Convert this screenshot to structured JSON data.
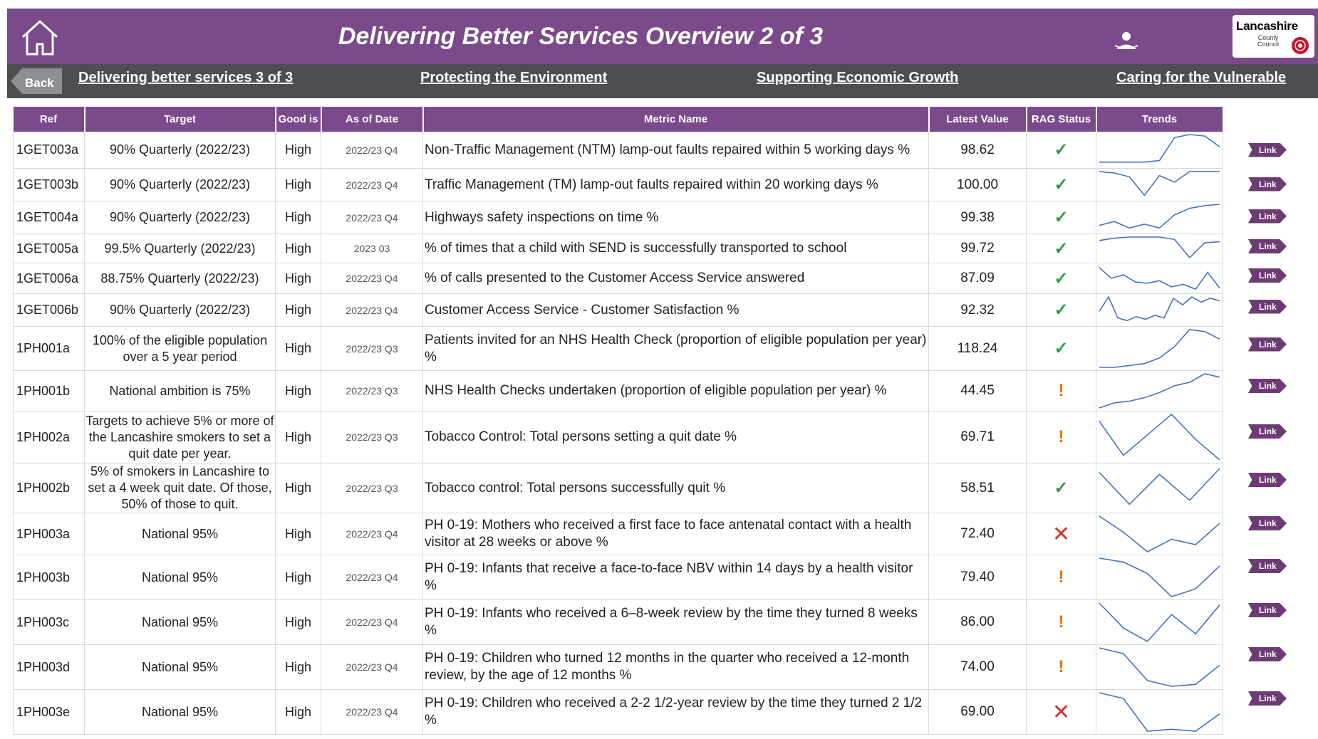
{
  "header": {
    "title": "Delivering Better Services Overview 2 of 3",
    "logo_title": "Lancashire",
    "logo_subtitle": "County Council"
  },
  "nav": {
    "back": "Back",
    "links": [
      "Delivering better services 3 of 3",
      "Protecting the Environment",
      "Supporting Economic Growth",
      "Caring for the Vulnerable"
    ]
  },
  "table": {
    "columns": [
      "Ref",
      "Target",
      "Good is",
      "As of Date",
      "Metric Name",
      "Latest Value",
      "RAG Status",
      "Trends"
    ],
    "link_label": "Link",
    "rows": [
      {
        "ref": "1GET003a",
        "target": "90% Quarterly (2022/23)",
        "good": "High",
        "asof": "2022/23 Q4",
        "metric": "Non-Traffic Management (NTM) lamp-out faults repaired within 5 working days %",
        "latest": "98.62",
        "rag": "green",
        "trend": [
          0.1,
          0.1,
          0.1,
          0.1,
          0.15,
          0.9,
          1.0,
          0.95,
          0.6
        ]
      },
      {
        "ref": "1GET003b",
        "target": "90% Quarterly (2022/23)",
        "good": "High",
        "asof": "2022/23 Q4",
        "metric": "Traffic Management (TM) lamp-out faults repaired within 20 working days %",
        "latest": "100.00",
        "rag": "green",
        "trend": [
          1.0,
          0.95,
          0.8,
          0.1,
          0.85,
          0.6,
          1.0,
          1.0,
          1.0
        ]
      },
      {
        "ref": "1GET004a",
        "target": "90% Quarterly (2022/23)",
        "good": "High",
        "asof": "2022/23 Q4",
        "metric": "Highways safety inspections on time %",
        "latest": "99.38",
        "rag": "green",
        "trend": [
          0.2,
          0.35,
          0.1,
          0.25,
          0.1,
          0.6,
          0.85,
          0.95,
          1.0
        ]
      },
      {
        "ref": "1GET005a",
        "target": "99.5% Quarterly (2022/23)",
        "good": "High",
        "asof": "2023 03",
        "metric": "% of times that a child with SEND is successfully transported to school",
        "latest": "99.72",
        "rag": "green",
        "trend": [
          0.85,
          0.95,
          1.0,
          1.0,
          1.0,
          0.9,
          0.1,
          0.75,
          0.8
        ]
      },
      {
        "ref": "1GET006a",
        "target": "88.75% Quarterly (2022/23)",
        "good": "High",
        "asof": "2022/23 Q4",
        "metric": "% of calls presented to the Customer Access Service answered",
        "latest": "87.09",
        "rag": "green",
        "trend": [
          0.95,
          0.5,
          0.65,
          0.35,
          0.3,
          0.4,
          0.15,
          0.25,
          0.05,
          0.75,
          0.1
        ]
      },
      {
        "ref": "1GET006b",
        "target": "90% Quarterly (2022/23)",
        "good": "High",
        "asof": "2022/23 Q4",
        "metric": "Customer Access Service - Customer Satisfaction %",
        "latest": "92.32",
        "rag": "green",
        "trend": [
          0.45,
          1.0,
          0.2,
          0.1,
          0.25,
          0.15,
          0.3,
          0.2,
          0.95,
          0.7,
          1.0,
          0.8,
          0.95,
          0.85
        ]
      },
      {
        "ref": "1PH001a",
        "target": "100% of the eligible population over a 5 year period",
        "good": "High",
        "asof": "2022/23 Q3",
        "metric": "Patients invited for an NHS Health Check (proportion of eligible population per year) %",
        "latest": "118.24",
        "rag": "green",
        "trend": [
          0.0,
          0.0,
          0.05,
          0.1,
          0.25,
          0.55,
          1.0,
          0.95,
          0.75
        ]
      },
      {
        "ref": "1PH001b",
        "target": "National ambition is 75%",
        "good": "High",
        "asof": "2022/23 Q3",
        "metric": "NHS Health Checks undertaken (proportion of eligible population per year) %",
        "latest": "44.45",
        "rag": "amber",
        "trend": [
          0.0,
          0.15,
          0.2,
          0.3,
          0.45,
          0.65,
          0.75,
          1.0,
          0.9
        ]
      },
      {
        "ref": "1PH002a",
        "target": "Targets to achieve 5% or more of the Lancashire smokers to set a quit date per year.",
        "good": "High",
        "asof": "2022/23 Q3",
        "metric": "Tobacco Control: Total persons setting a quit date %",
        "latest": "69.71",
        "rag": "amber",
        "trend": [
          0.85,
          0.1,
          0.55,
          1.0,
          0.45,
          0.0
        ]
      },
      {
        "ref": "1PH002b",
        "target": "5% of smokers in Lancashire to set a 4 week quit date. Of those, 50% of those to quit.",
        "good": "High",
        "asof": "2022/23 Q3",
        "metric": "Tobacco control: Total persons successfully quit %",
        "latest": "58.51",
        "rag": "green",
        "trend": [
          0.9,
          0.1,
          0.85,
          0.2,
          1.0
        ]
      },
      {
        "ref": "1PH003a",
        "target": "National 95%",
        "good": "High",
        "asof": "2022/23 Q4",
        "metric": "PH 0-19: Mothers who received a first face to face antenatal contact with a health visitor at 28 weeks or above %",
        "latest": "72.40",
        "rag": "red",
        "trend": [
          1.0,
          0.55,
          0.0,
          0.35,
          0.2,
          0.8
        ]
      },
      {
        "ref": "1PH003b",
        "target": "National 95%",
        "good": "High",
        "asof": "2022/23 Q4",
        "metric": "PH 0-19: Infants that receive a face-to-face NBV within 14 days by a health visitor %",
        "latest": "79.40",
        "rag": "amber",
        "trend": [
          1.0,
          0.9,
          0.6,
          0.0,
          0.2,
          0.8
        ]
      },
      {
        "ref": "1PH003c",
        "target": "National 95%",
        "good": "High",
        "asof": "2022/23 Q4",
        "metric": "PH 0-19: Infants who received a 6–8-week review by the time they turned 8 weeks %",
        "latest": "86.00",
        "rag": "amber",
        "trend": [
          1.0,
          0.35,
          0.0,
          0.7,
          0.2,
          0.95
        ]
      },
      {
        "ref": "1PH003d",
        "target": "National 95%",
        "good": "High",
        "asof": "2022/23 Q4",
        "metric": "PH 0-19: Children who turned 12 months in the quarter who received a 12-month review, by the age of 12 months %",
        "latest": "74.00",
        "rag": "amber",
        "trend": [
          1.0,
          0.85,
          0.15,
          0.0,
          0.05,
          0.55
        ]
      },
      {
        "ref": "1PH003e",
        "target": "National 95%",
        "good": "High",
        "asof": "2022/23 Q4",
        "metric": "PH 0-19: Children who received a 2-2 1/2-year review by the time they turned 2 1/2 %",
        "latest": "69.00",
        "rag": "red",
        "trend": [
          1.0,
          0.85,
          0.0,
          0.05,
          0.0,
          0.45
        ]
      }
    ]
  }
}
